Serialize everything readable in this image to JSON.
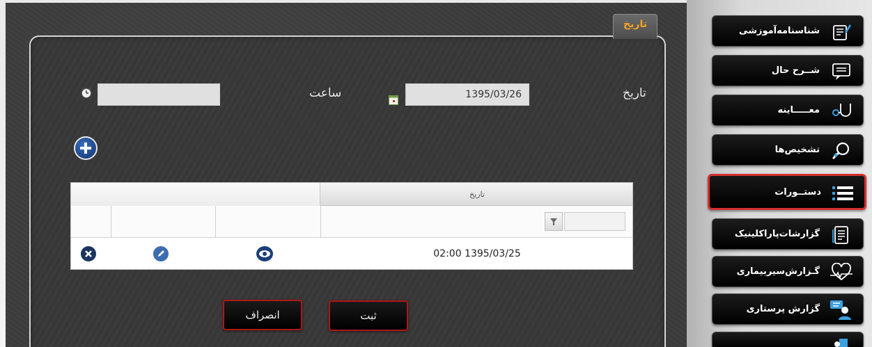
{
  "panel": {
    "tab_label": "تاریخ"
  },
  "form": {
    "date_label": "تاریخ",
    "date_value": "1395/03/26",
    "time_label": "ساعت",
    "time_value": ""
  },
  "table": {
    "header": "تاریخ",
    "rows": [
      {
        "datetime": "02:00 1395/03/25"
      }
    ]
  },
  "buttons": {
    "submit": "ثبت",
    "cancel": "انصراف"
  },
  "sidebar": {
    "items": [
      {
        "label": "شناسنامه‌آموزشی",
        "icon": "edit-document-icon"
      },
      {
        "label": "شــرح حال",
        "icon": "chat-icon"
      },
      {
        "label": "معـــــاینه",
        "icon": "stethoscope-icon"
      },
      {
        "label": "تشخیص‌ها",
        "icon": "magnifier-icon"
      },
      {
        "label": "دستــورات",
        "icon": "list-icon"
      },
      {
        "label": "گزارشات‌پاراکلینیک",
        "icon": "report-icon"
      },
      {
        "label": "گـزارش‌سیربیماری",
        "icon": "heartbeat-icon"
      },
      {
        "label": "گزارش پرستاری",
        "icon": "nurse-icon"
      }
    ]
  },
  "colors": {
    "accent_tab": "#f5a623",
    "active_border": "#d33030",
    "button_border": "#b01717"
  }
}
